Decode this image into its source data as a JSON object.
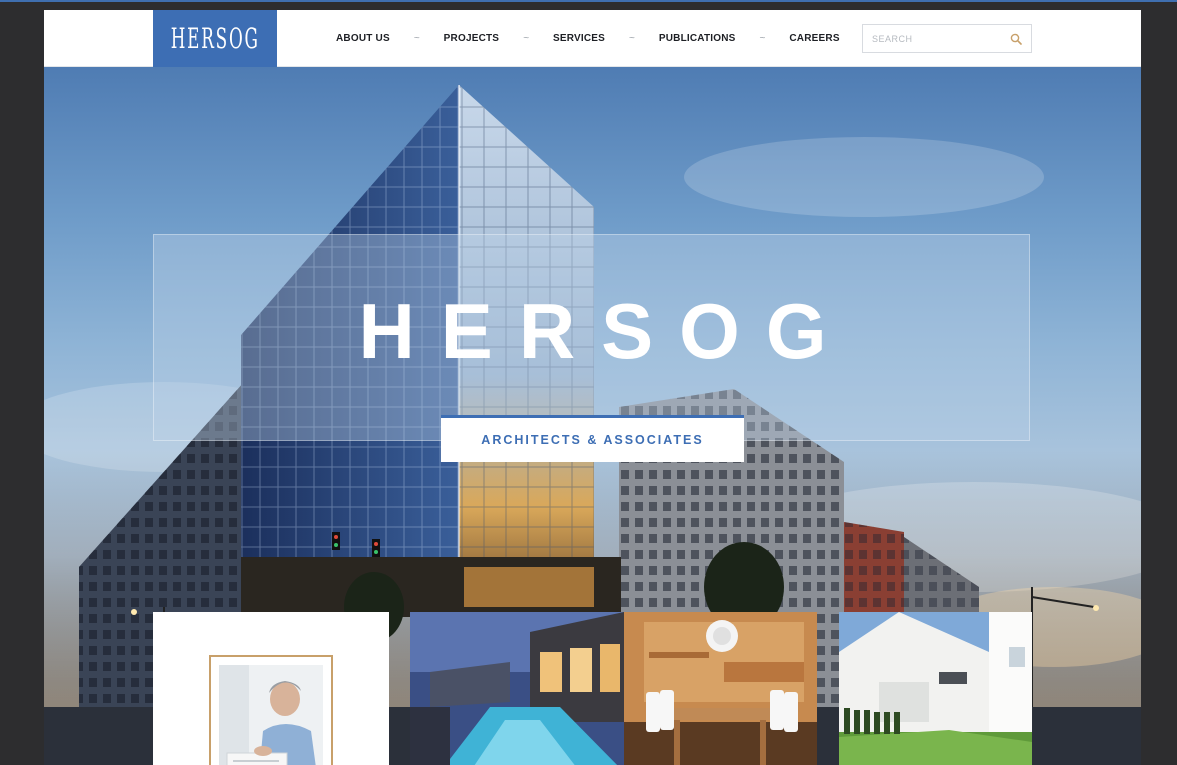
{
  "header": {
    "logo_text": "HERSOG",
    "nav": [
      {
        "label": "ABOUT US"
      },
      {
        "label": "PROJECTS"
      },
      {
        "label": "SERVICES"
      },
      {
        "label": "PUBLICATIONS"
      },
      {
        "label": "CAREERS"
      }
    ],
    "nav_separator": "~",
    "search_placeholder": "SEARCH"
  },
  "hero": {
    "title": "HERSOG",
    "subtitle": "ARCHITECTS & ASSOCIATES"
  },
  "colors": {
    "brand_blue": "#3d6eb4",
    "frame_gold": "#c8a06a",
    "nav_text": "#1d1f24"
  },
  "icons": {
    "search": "search-icon"
  }
}
